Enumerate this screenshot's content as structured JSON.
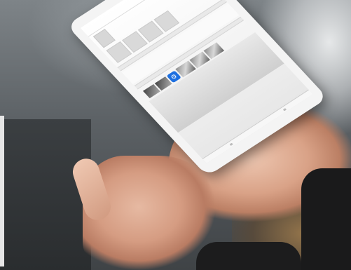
{
  "scene": {
    "description_colors": {
      "tablet_frame": "#f4f4f4",
      "screen_bg": "#ffffff",
      "accent_blue": "#1d6fe0",
      "skin": "#d9a287",
      "sleeve": "#1a1a1b"
    }
  },
  "tablet": {
    "statusbar": {
      "left": "",
      "right": ""
    },
    "navbar": {
      "back": "",
      "title": "",
      "action": ""
    },
    "item": {
      "id": "",
      "meta": [
        "",
        "",
        ""
      ]
    },
    "sections": [
      "",
      ""
    ],
    "app_icon": "gear-icon"
  }
}
